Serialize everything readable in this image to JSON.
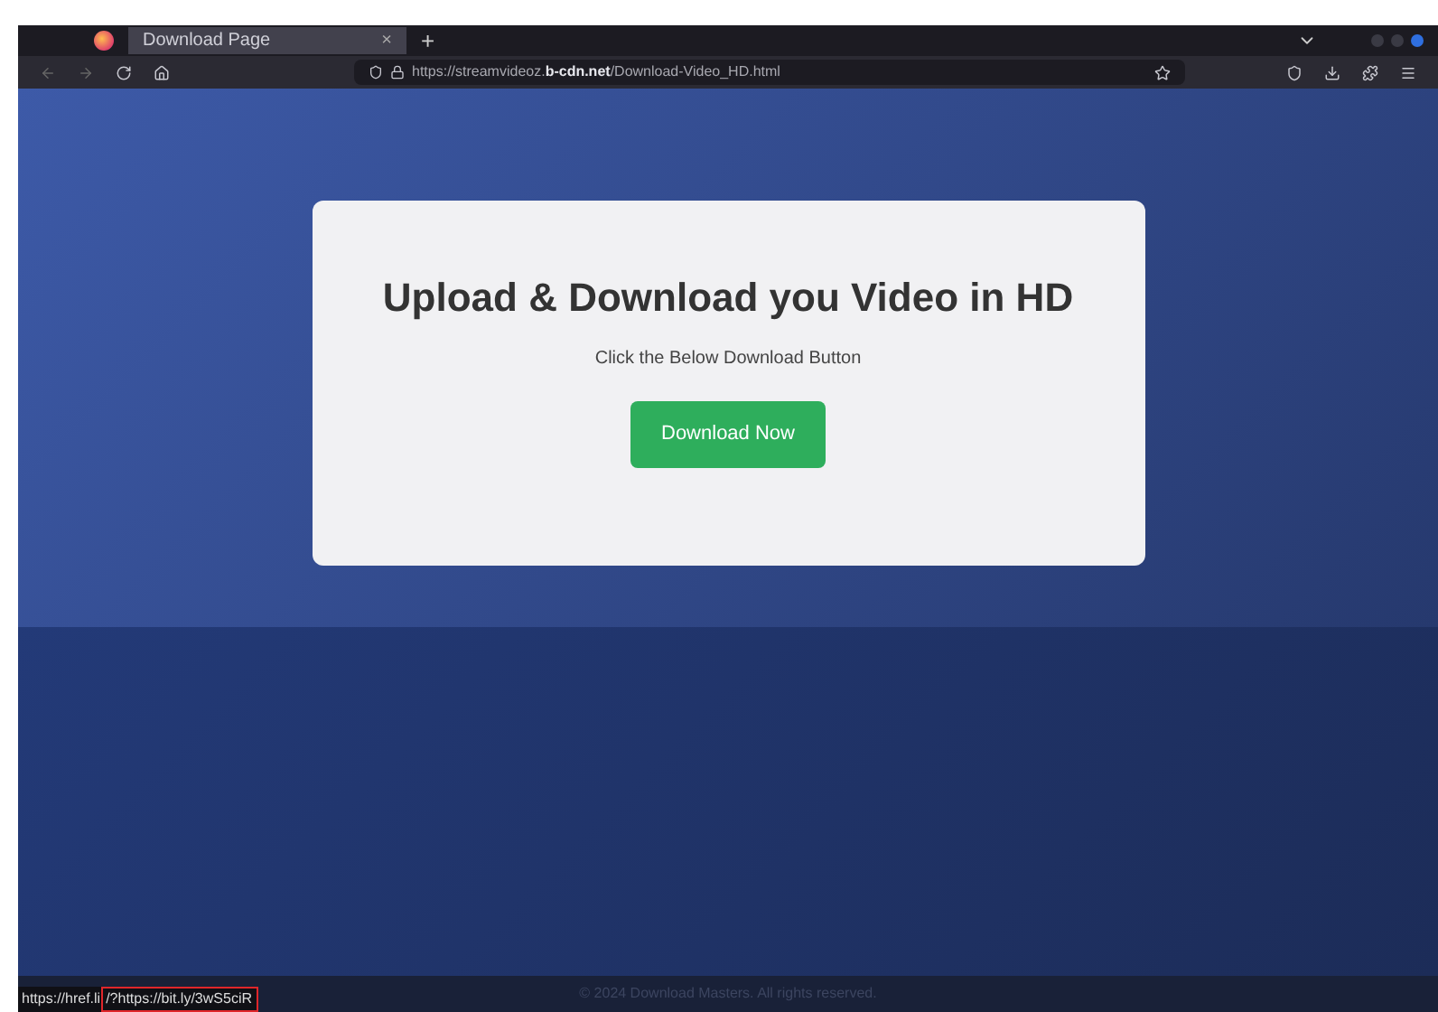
{
  "browser": {
    "tabs": [
      {
        "label": "Download Page",
        "selected": true
      }
    ],
    "new_tab": "+",
    "close": "×",
    "url": {
      "prefix": "https://streamvideoz.",
      "domain": "b-cdn.net",
      "path": "/Download-Video_HD.html"
    }
  },
  "card": {
    "heading": "Upload & Download you Video in HD",
    "subtext": "Click the Below Download Button",
    "button": "Download Now"
  },
  "footer": "© 2024 Download Masters. All rights reserved.",
  "status_link": {
    "start": "https://href.li",
    "highlighted": "/?https://bit.ly/3wS5ciR"
  }
}
